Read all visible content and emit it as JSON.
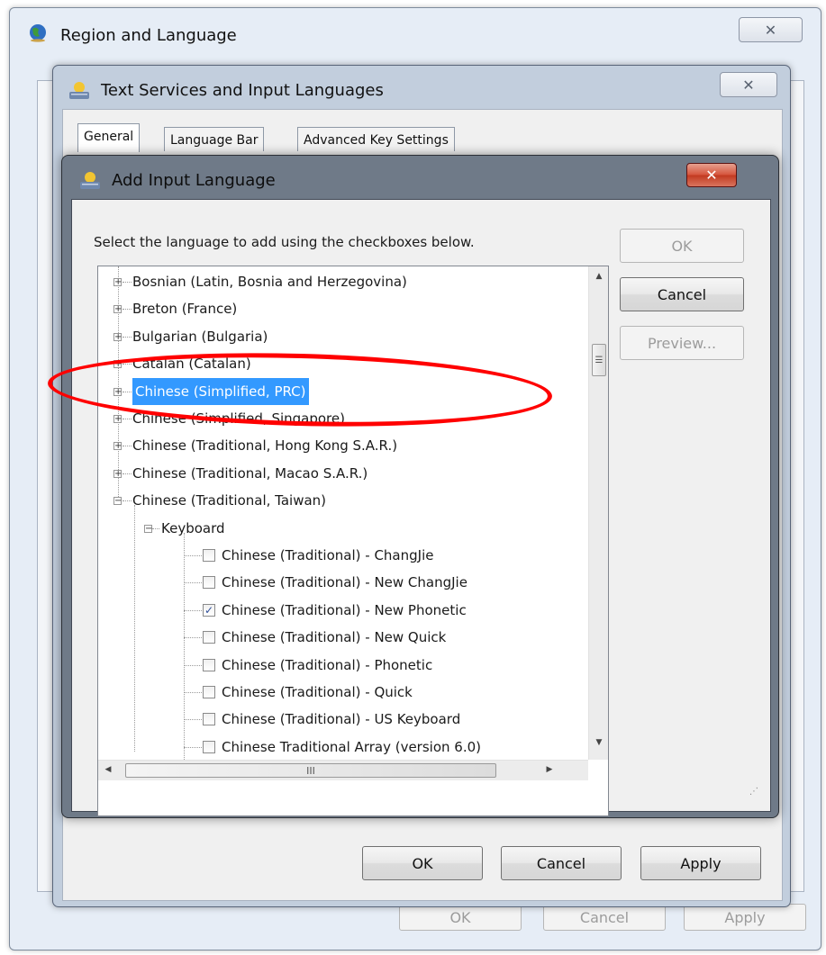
{
  "region_window": {
    "title": "Region and Language",
    "icon": "globe-icon",
    "buttons": {
      "ok": "OK",
      "cancel": "Cancel",
      "apply": "Apply"
    }
  },
  "textsvc_window": {
    "title": "Text Services and Input Languages",
    "icon": "keyboard-icon",
    "tabs": [
      "General",
      "Language Bar",
      "Advanced Key Settings"
    ],
    "buttons": {
      "ok": "OK",
      "cancel": "Cancel",
      "apply": "Apply"
    }
  },
  "addlang_window": {
    "title": "Add Input Language",
    "icon": "keyboard-icon",
    "instruction": "Select the language to add using the checkboxes below.",
    "buttons": {
      "ok": "OK",
      "cancel": "Cancel",
      "preview": "Preview..."
    }
  },
  "tree": {
    "languages": [
      "Bosnian (Latin, Bosnia and Herzegovina)",
      "Breton (France)",
      "Bulgarian (Bulgaria)",
      "Catalan (Catalan)",
      "Chinese (Simplified, PRC)",
      "Chinese (Simplified, Singapore)",
      "Chinese (Traditional, Hong Kong S.A.R.)",
      "Chinese (Traditional, Macao S.A.R.)",
      "Chinese (Traditional, Taiwan)"
    ],
    "selected": "Chinese (Simplified, PRC)",
    "keyboard_label": "Keyboard",
    "keyboards": [
      {
        "label": "Chinese (Traditional) - ChangJie",
        "checked": false
      },
      {
        "label": "Chinese (Traditional) - New ChangJie",
        "checked": false
      },
      {
        "label": "Chinese (Traditional) - New Phonetic",
        "checked": true
      },
      {
        "label": "Chinese (Traditional) - New Quick",
        "checked": false
      },
      {
        "label": "Chinese (Traditional) - Phonetic",
        "checked": false
      },
      {
        "label": "Chinese (Traditional) - Quick",
        "checked": false
      },
      {
        "label": "Chinese (Traditional) - US Keyboard",
        "checked": false
      },
      {
        "label": "Chinese Traditional Array (version 6.0)",
        "checked": false
      }
    ],
    "hscroll_thumb_glyph": "III",
    "vscroll_thumb_glyph": "☰"
  },
  "annotation": {
    "color": "#ff0000"
  },
  "colors": {
    "selection": "#3399ff",
    "window_frame": "#c2cedd"
  }
}
